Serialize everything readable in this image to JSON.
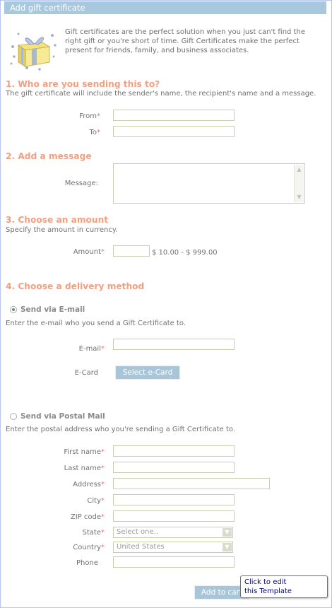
{
  "header": {
    "title": "Add gift certificate"
  },
  "intro": {
    "text": "Gift certificates are the perfect solution when you just can't find the right gift or you're short of time. Gift Certificates make the perfect present for friends, family, and business associates."
  },
  "section1": {
    "heading": "1. Who are you sending this to?",
    "description": "The gift certificate will include the sender's name, the recipient's name and a message.",
    "from_label": "From",
    "to_label": "To",
    "from_value": "",
    "to_value": ""
  },
  "section2": {
    "heading": "2. Add a message",
    "message_label": "Message:",
    "message_value": ""
  },
  "section3": {
    "heading": "3. Choose an amount",
    "description": "Specify the amount in currency.",
    "amount_label": "Amount",
    "amount_value": "",
    "range": "$ 10.00 - $ 999.00"
  },
  "section4": {
    "heading": "4. Choose a delivery method",
    "email_option": {
      "label": "Send via E-mail",
      "selected": true,
      "description": "Enter the e-mail who you send a Gift Certificate to.",
      "email_label": "E-mail",
      "email_value": "",
      "ecard_label": "E-Card",
      "select_ecard_button": "Select e-Card"
    },
    "postal_option": {
      "label": "Send via Postal Mail",
      "selected": false,
      "description": "Enter the postal address who you're sending a Gift Certificate to.",
      "fields": {
        "first_name": "First name",
        "last_name": "Last name",
        "address": "Address",
        "city": "City",
        "zip": "ZIP code",
        "state": "State",
        "country": "Country",
        "phone": "Phone"
      },
      "state_value": "Select one..",
      "country_value": "United States"
    }
  },
  "footer": {
    "add_to_cart_button": "Add to cart"
  },
  "tooltip": {
    "line1": "Click to edit",
    "line2": "this Template"
  },
  "required_mark": "*"
}
